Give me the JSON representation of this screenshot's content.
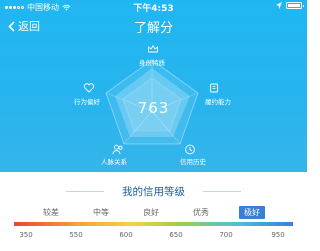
{
  "status_bar": {
    "carrier": "中国移动",
    "time": "下午4:53"
  },
  "nav": {
    "back_label": "返回",
    "title": "了解分"
  },
  "radar": {
    "score": "763",
    "dimensions": [
      {
        "label": "身份特质",
        "icon": "crown-icon"
      },
      {
        "label": "履约能力",
        "icon": "handshake-icon"
      },
      {
        "label": "信用历史",
        "icon": "clock-icon"
      },
      {
        "label": "人脉关系",
        "icon": "people-icon"
      },
      {
        "label": "行为偏好",
        "icon": "heart-icon"
      }
    ]
  },
  "credit_level": {
    "title": "我的信用等级",
    "levels": [
      {
        "label": "较差"
      },
      {
        "label": "中等"
      },
      {
        "label": "良好"
      },
      {
        "label": "优秀"
      },
      {
        "label": "极好",
        "active": true
      }
    ],
    "ticks": [
      "350",
      "550",
      "600",
      "650",
      "700",
      "950"
    ]
  }
}
